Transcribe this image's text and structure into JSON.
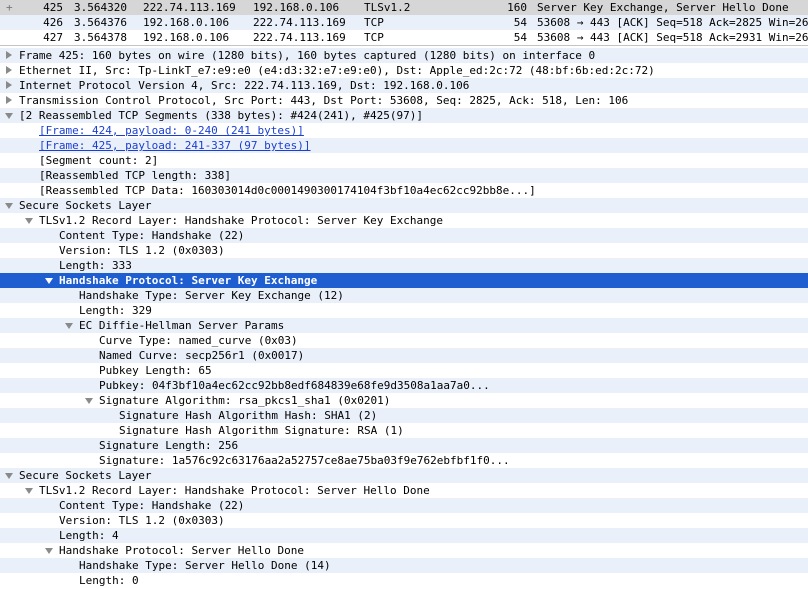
{
  "packet_list": [
    {
      "marker": "+",
      "no": "425",
      "time": "3.564320",
      "source": "222.74.113.169",
      "destination": "192.168.0.106",
      "protocol": "TLSv1.2",
      "length": "160",
      "info": "Server Key Exchange, Server Hello Done"
    },
    {
      "marker": "",
      "no": "426",
      "time": "3.564376",
      "source": "192.168.0.106",
      "destination": "222.74.113.169",
      "protocol": "TCP",
      "length": "54",
      "info": "53608 → 443 [ACK] Seq=518 Ack=2825 Win=26"
    },
    {
      "marker": "",
      "no": "427",
      "time": "3.564378",
      "source": "192.168.0.106",
      "destination": "222.74.113.169",
      "protocol": "TCP",
      "length": "54",
      "info": "53608 → 443 [ACK] Seq=518 Ack=2931 Win=26"
    }
  ],
  "tree": [
    {
      "level": 0,
      "toggle": "collapsed",
      "text": "Frame 425: 160 bytes on wire (1280 bits), 160 bytes captured (1280 bits) on interface 0"
    },
    {
      "level": 0,
      "toggle": "collapsed",
      "text": "Ethernet II, Src: Tp-LinkT_e7:e9:e0 (e4:d3:32:e7:e9:e0), Dst: Apple_ed:2c:72 (48:bf:6b:ed:2c:72)"
    },
    {
      "level": 0,
      "toggle": "collapsed",
      "text": "Internet Protocol Version 4, Src: 222.74.113.169, Dst: 192.168.0.106"
    },
    {
      "level": 0,
      "toggle": "collapsed",
      "text": "Transmission Control Protocol, Src Port: 443, Dst Port: 53608, Seq: 2825, Ack: 518, Len: 106"
    },
    {
      "level": 0,
      "toggle": "expanded",
      "text": "[2 Reassembled TCP Segments (338 bytes): #424(241), #425(97)]"
    },
    {
      "level": 1,
      "toggle": "none",
      "link": true,
      "text": "[Frame: 424, payload: 0-240 (241 bytes)]"
    },
    {
      "level": 1,
      "toggle": "none",
      "link": true,
      "text": "[Frame: 425, payload: 241-337 (97 bytes)]"
    },
    {
      "level": 1,
      "toggle": "none",
      "text": "[Segment count: 2]"
    },
    {
      "level": 1,
      "toggle": "none",
      "text": "[Reassembled TCP length: 338]"
    },
    {
      "level": 1,
      "toggle": "none",
      "text": "[Reassembled TCP Data: 160303014d0c0001490300174104f3bf10a4ec62cc92bb8e...]"
    },
    {
      "level": 0,
      "toggle": "expanded",
      "text": "Secure Sockets Layer"
    },
    {
      "level": 1,
      "toggle": "expanded",
      "text": "TLSv1.2 Record Layer: Handshake Protocol: Server Key Exchange"
    },
    {
      "level": 2,
      "toggle": "none",
      "text": "Content Type: Handshake (22)"
    },
    {
      "level": 2,
      "toggle": "none",
      "text": "Version: TLS 1.2 (0x0303)"
    },
    {
      "level": 2,
      "toggle": "none",
      "text": "Length: 333"
    },
    {
      "level": 2,
      "toggle": "expanded",
      "selected": true,
      "text": "Handshake Protocol: Server Key Exchange"
    },
    {
      "level": 3,
      "toggle": "none",
      "text": "Handshake Type: Server Key Exchange (12)"
    },
    {
      "level": 3,
      "toggle": "none",
      "text": "Length: 329"
    },
    {
      "level": 3,
      "toggle": "expanded",
      "text": "EC Diffie-Hellman Server Params"
    },
    {
      "level": 4,
      "toggle": "none",
      "text": "Curve Type: named_curve (0x03)"
    },
    {
      "level": 4,
      "toggle": "none",
      "text": "Named Curve: secp256r1 (0x0017)"
    },
    {
      "level": 4,
      "toggle": "none",
      "text": "Pubkey Length: 65"
    },
    {
      "level": 4,
      "toggle": "none",
      "text": "Pubkey: 04f3bf10a4ec62cc92bb8edf684839e68fe9d3508a1aa7a0..."
    },
    {
      "level": 4,
      "toggle": "expanded",
      "text": "Signature Algorithm: rsa_pkcs1_sha1 (0x0201)"
    },
    {
      "level": 5,
      "toggle": "none",
      "text": "Signature Hash Algorithm Hash: SHA1 (2)"
    },
    {
      "level": 5,
      "toggle": "none",
      "text": "Signature Hash Algorithm Signature: RSA (1)"
    },
    {
      "level": 4,
      "toggle": "none",
      "text": "Signature Length: 256"
    },
    {
      "level": 4,
      "toggle": "none",
      "text": "Signature: 1a576c92c63176aa2a52757ce8ae75ba03f9e762ebfbf1f0..."
    },
    {
      "level": 0,
      "toggle": "expanded",
      "text": "Secure Sockets Layer"
    },
    {
      "level": 1,
      "toggle": "expanded",
      "text": "TLSv1.2 Record Layer: Handshake Protocol: Server Hello Done"
    },
    {
      "level": 2,
      "toggle": "none",
      "text": "Content Type: Handshake (22)"
    },
    {
      "level": 2,
      "toggle": "none",
      "text": "Version: TLS 1.2 (0x0303)"
    },
    {
      "level": 2,
      "toggle": "none",
      "text": "Length: 4"
    },
    {
      "level": 2,
      "toggle": "expanded",
      "text": "Handshake Protocol: Server Hello Done"
    },
    {
      "level": 3,
      "toggle": "none",
      "text": "Handshake Type: Server Hello Done (14)"
    },
    {
      "level": 3,
      "toggle": "none",
      "text": "Length: 0"
    }
  ],
  "colors": {
    "selection": "#1f5ed1",
    "alt_row": "#eaf0fa",
    "selected_packet": "#d6d6d6",
    "link": "#1a3fd1"
  }
}
